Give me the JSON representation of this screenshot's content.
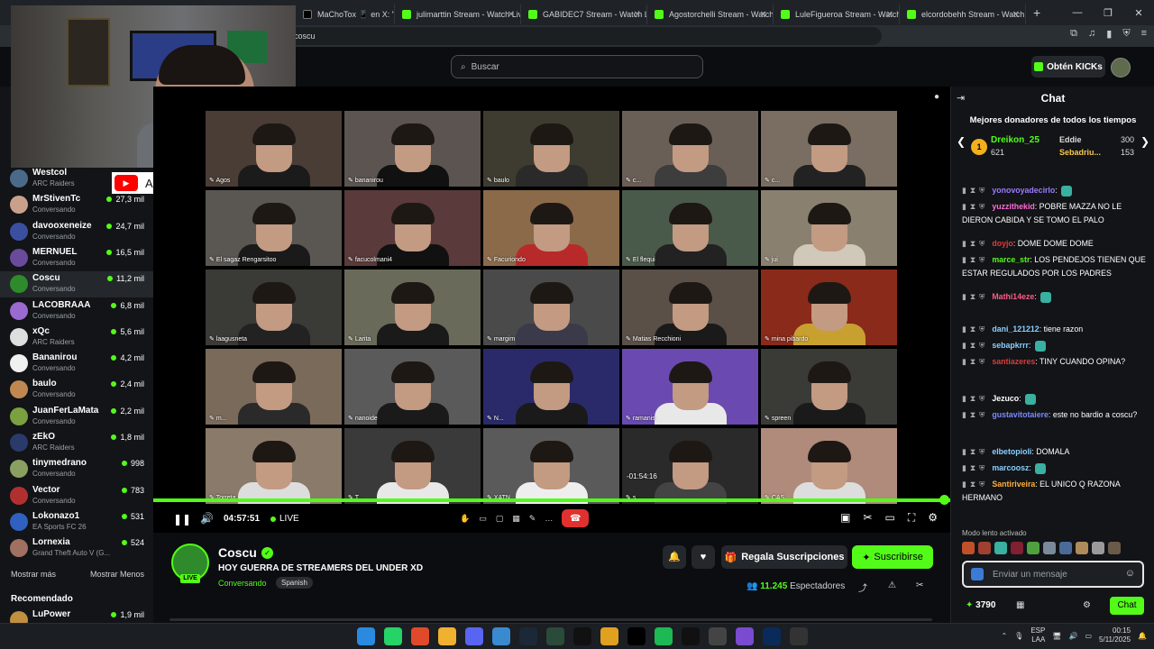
{
  "browser": {
    "tabs": [
      {
        "label": "MaChoTox 📱 en X: \"Mal ah",
        "icon": "x-icon"
      },
      {
        "label": "julimarttin Stream - Watch Live",
        "icon": "kick-icon"
      },
      {
        "label": "GABIDEC7 Stream - Watch Live",
        "icon": "kick-icon"
      },
      {
        "label": "Agostorchelli Stream - Watch L",
        "icon": "kick-icon"
      },
      {
        "label": "LuleFigueroa Stream - Watch L",
        "icon": "kick-icon"
      },
      {
        "label": "elcordobehh Stream - Watch L",
        "icon": "kick-icon"
      }
    ],
    "url": "coscu"
  },
  "kick": {
    "search_placeholder": "Buscar",
    "get_kicks": "Obtén KICKs"
  },
  "overlay": {
    "yt_name": "Adruh"
  },
  "sidebar": {
    "items": [
      {
        "name": "Westcol",
        "category": "ARC Raiders",
        "viewers": "",
        "color": "#4b6a8a"
      },
      {
        "name": "MrStivenTc",
        "category": "Conversando",
        "viewers": "27,3 mil",
        "color": "#c9a18a"
      },
      {
        "name": "davooxeneize",
        "category": "Conversando",
        "viewers": "24,7 mil",
        "color": "#3a4fa0"
      },
      {
        "name": "MERNUEL",
        "category": "Conversando",
        "viewers": "16,5 mil",
        "color": "#6a4a9a"
      },
      {
        "name": "Coscu",
        "category": "Conversando",
        "viewers": "11,2 mil",
        "color": "#2e8a2a"
      },
      {
        "name": "LACOBRAAA",
        "category": "Conversando",
        "viewers": "6,8 mil",
        "color": "#9a6ad0"
      },
      {
        "name": "xQc",
        "category": "ARC Raiders",
        "viewers": "5,6 mil",
        "color": "#dedede"
      },
      {
        "name": "Bananirou",
        "category": "Conversando",
        "viewers": "4,2 mil",
        "color": "#f0f0f0"
      },
      {
        "name": "baulo",
        "category": "Conversando",
        "viewers": "2,4 mil",
        "color": "#c08850"
      },
      {
        "name": "JuanFerLaMata",
        "category": "Conversando",
        "viewers": "2,2 mil",
        "color": "#7aa040"
      },
      {
        "name": "zEkO",
        "category": "ARC Raiders",
        "viewers": "1,8 mil",
        "color": "#2a3a6a"
      },
      {
        "name": "tinymedrano",
        "category": "Conversando",
        "viewers": "998",
        "color": "#8aa060"
      },
      {
        "name": "Vector",
        "category": "Conversando",
        "viewers": "783",
        "color": "#b03030"
      },
      {
        "name": "Lokonazo1",
        "category": "EA Sports FC 26",
        "viewers": "531",
        "color": "#3060c0"
      },
      {
        "name": "Lornexia",
        "category": "Grand Theft Auto V (G...",
        "viewers": "524",
        "color": "#a07060"
      }
    ],
    "show_more": "Mostrar más",
    "show_less": "Mostrar Menos",
    "recommended": "Recomendado",
    "recommended_first": {
      "name": "LuPower",
      "viewers": "1,9 mil"
    }
  },
  "player": {
    "tiles": [
      {
        "label": "Agos",
        "bg": "#4a3d36",
        "body": "#1b1b1b"
      },
      {
        "label": "bananirou",
        "bg": "#5b5450",
        "body": "#111"
      },
      {
        "label": "baulo",
        "bg": "#3e3c30",
        "body": "#2a2a2a"
      },
      {
        "label": "c...",
        "bg": "#6a5f57",
        "body": "#3d3d3d"
      },
      {
        "label": "c...",
        "bg": "#7a6d62",
        "body": "#222"
      },
      {
        "label": "El sagaz Rengarsitoo",
        "bg": "#5a5652",
        "body": "#1a1a1a"
      },
      {
        "label": "facucolmani4",
        "bg": "#5a3a3a",
        "body": "#111"
      },
      {
        "label": "Facuriondo",
        "bg": "#8b6a4a",
        "body": "#b82a2a"
      },
      {
        "label": "El flequi",
        "bg": "#4a5a4a",
        "body": "#222"
      },
      {
        "label": "jui",
        "bg": "#8a8070",
        "body": "#d0c8b8"
      },
      {
        "label": "laagusneta",
        "bg": "#3a3a36",
        "body": "#222"
      },
      {
        "label": "Larita",
        "bg": "#6a6a5a",
        "body": "#1a1a1a"
      },
      {
        "label": "margim",
        "bg": "#4a4a4a",
        "body": "#3a3a4a"
      },
      {
        "label": "Matias Recchioni",
        "bg": "#5a5048",
        "body": "#1a1a1a"
      },
      {
        "label": "mina pibardo",
        "bg": "#8a2a1a",
        "body": "#c8a030"
      },
      {
        "label": "m...",
        "bg": "#7a6a5a",
        "body": "#2a2a2a"
      },
      {
        "label": "nanoide",
        "bg": "#5a5a5a",
        "body": "#1a1a1a"
      },
      {
        "label": "N...",
        "bg": "#2a2a6a",
        "body": "#1a1a1a"
      },
      {
        "label": "ramanis",
        "bg": "#6a4ab0",
        "body": "#e8e8e8"
      },
      {
        "label": "spreen",
        "bg": "#3a3a36",
        "body": "#1a1a1a"
      },
      {
        "label": "Torreta",
        "bg": "#8a7a6a",
        "body": "#ddd"
      },
      {
        "label": "T...",
        "bg": "#3a3a3a",
        "body": "#e8e8e8"
      },
      {
        "label": "XATN",
        "bg": "#5a5a5a",
        "body": "#eee"
      },
      {
        "label": "s...",
        "bg": "#2a2a2a",
        "body": "#444"
      },
      {
        "label": "CAS",
        "bg": "#b08a7a",
        "body": "#ddd"
      }
    ],
    "seek_tooltip": "-01:54:16",
    "time": "04:57:51",
    "live_label": "LIVE"
  },
  "stream": {
    "channel": "Coscu",
    "title": "HOY GUERRA DE STREAMERS DEL UNDER XD",
    "category": "Conversando",
    "language": "Spanish",
    "live_chip": "LIVE",
    "gift_subs": "Regala Suscripciones",
    "subscribe": "Suscribirse",
    "viewers_count": "11.245",
    "viewers_label": "Espectadores"
  },
  "chat": {
    "title": "Chat",
    "top_donors_title": "Mejores donadores de todos los tiempos",
    "donors": [
      {
        "rank": "1",
        "name": "Dreikon_25",
        "value": "621"
      },
      {
        "name": "Eddie",
        "value": "300"
      },
      {
        "name": "Sebadriu...",
        "value": "153"
      }
    ],
    "messages": [
      {
        "user": "yonovoyadecirlo",
        "color": "#9b7bff",
        "text": ""
      },
      {
        "user": "yuzzithekid",
        "color": "#ff6ad5",
        "text": "POBRE MAZZA NO LE DIERON CABIDA Y SE TOMO EL PALO"
      },
      {
        "user": "doyjo",
        "color": "#e03a3a",
        "text": "DOME DOME DOME"
      },
      {
        "user": "marce_str",
        "color": "#53fc18",
        "text": "LOS PENDEJOS TIENEN QUE ESTAR REGULADOS POR LOS PADRES"
      },
      {
        "user": "Mathi14eze",
        "color": "#ff5a8a",
        "text": ""
      },
      {
        "user": "dani_121212",
        "color": "#8ad0ff",
        "text": "tiene razon"
      },
      {
        "user": "sebapkrrr",
        "color": "#8ad0ff",
        "text": ""
      },
      {
        "user": "santiazeres",
        "color": "#e03a3a",
        "text": "TINY CUANDO OPINA?"
      },
      {
        "user": "Jezuco",
        "color": "#ffffff",
        "text": ""
      },
      {
        "user": "gustavitotaiere",
        "color": "#7a8aff",
        "text": "este no bardio a coscu?"
      },
      {
        "user": "elbetopioli",
        "color": "#8ad0ff",
        "text": "DOMALA"
      },
      {
        "user": "marcoosz",
        "color": "#8ad0ff",
        "text": ""
      },
      {
        "user": "Santiriveira",
        "color": "#ffb040",
        "text": "EL UNICO Q RAZONA HERMANO"
      }
    ],
    "slow_mode": "Modo lento activado",
    "input_placeholder": "Enviar un mensaje",
    "points": "3790",
    "send": "Chat"
  },
  "taskbar": {
    "lang": "ESP",
    "layout": "LAA",
    "time": "00:15",
    "date": "5/11/2025"
  }
}
